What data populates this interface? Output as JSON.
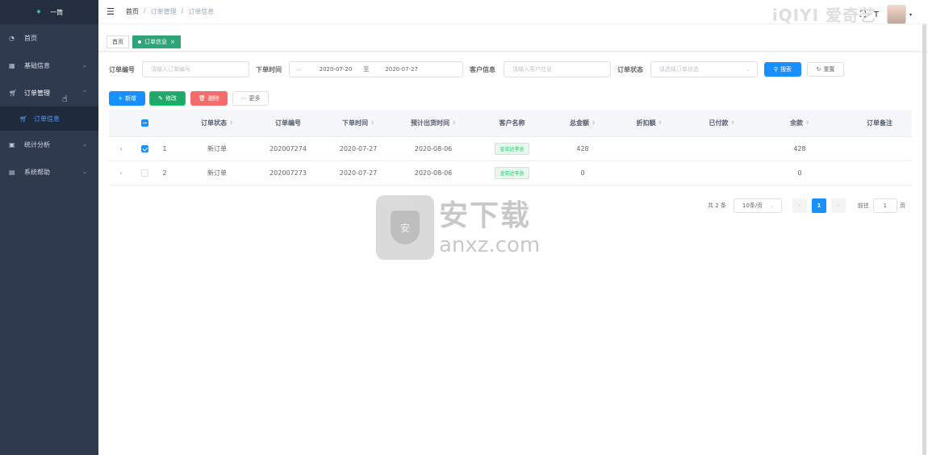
{
  "logo": {
    "text": "一筒"
  },
  "sidebar": {
    "items": [
      {
        "label": "首页",
        "icon": "dashboard-icon"
      },
      {
        "label": "基础信息",
        "icon": "grid-icon"
      },
      {
        "label": "订单管理",
        "icon": "cart-icon"
      },
      {
        "label": "统计分析",
        "icon": "monitor-icon"
      },
      {
        "label": "系统帮助",
        "icon": "briefcase-icon"
      }
    ],
    "sub_item": {
      "label": "订单信息",
      "icon": "cart-icon"
    }
  },
  "header": {
    "breadcrumb": [
      "首页",
      "/",
      "订单管理",
      "/",
      "订单信息"
    ],
    "iqiyi": "iQIYI 爱奇艺"
  },
  "tags": {
    "home": "首页",
    "active": "订单信息",
    "close": "×"
  },
  "filter": {
    "order_no_label": "订单编号",
    "order_no_placeholder": "请输入订单编号",
    "time_label": "下单时间",
    "date_start": "2020-07-20",
    "date_sep": "至",
    "date_end": "2020-07-27",
    "customer_label": "客户信息",
    "customer_placeholder": "请输入客户信息",
    "status_label": "订单状态",
    "status_placeholder": "请选择订单状态",
    "search_btn": "搜索",
    "reset_btn": "重置"
  },
  "toolbar": {
    "add": "新增",
    "edit": "修改",
    "delete": "删除",
    "more": "更多"
  },
  "table": {
    "columns": [
      "订单状态",
      "订单编号",
      "下单时间",
      "预计出货时间",
      "客户名称",
      "总金额",
      "折扣额",
      "已付款",
      "余款",
      "订单备注"
    ],
    "rows": [
      {
        "index": "1",
        "status": "新订单",
        "order_no": "202007274",
        "order_time": "2020-07-27",
        "ship_time": "2020-08-06",
        "customer": "金宏达李总",
        "total": "428",
        "discount": "",
        "paid": "",
        "balance": "428",
        "remark": "",
        "checked": true
      },
      {
        "index": "2",
        "status": "新订单",
        "order_no": "202007273",
        "order_time": "2020-07-27",
        "ship_time": "2020-08-06",
        "customer": "金宏达李总",
        "total": "0",
        "discount": "",
        "paid": "",
        "balance": "0",
        "remark": "",
        "checked": false
      }
    ]
  },
  "pagination": {
    "total": "共 2 条",
    "page_size": "10条/页",
    "current": "1",
    "goto_label": "前往",
    "goto_value": "1",
    "page_unit": "页"
  },
  "watermark": {
    "cn": "安下载",
    "en": "anxz.com",
    "badge": "安"
  }
}
